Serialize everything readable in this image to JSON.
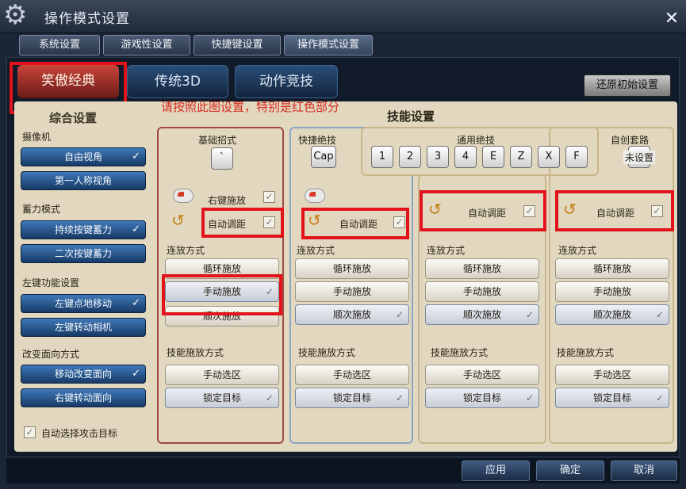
{
  "window": {
    "title": "操作模式设置",
    "close_glyph": "✕"
  },
  "top_tabs": [
    "系统设置",
    "游戏性设置",
    "快捷键设置",
    "操作模式设置"
  ],
  "mode_tabs": [
    "笑傲经典",
    "传统3D",
    "动作竞技"
  ],
  "restore_label": "还原初始设置",
  "notice": "请按照此图设置，特别是红色部分",
  "left": {
    "title": "综合设置",
    "camera_label": "摄像机",
    "camera_opts": [
      "自由视角",
      "第一人称视角"
    ],
    "charge_label": "蓄力模式",
    "charge_opts": [
      "持续按键蓄力",
      "二次按键蓄力"
    ],
    "leftkey_label": "左键功能设置",
    "leftkey_opts": [
      "左键点地移动",
      "左键转动相机"
    ],
    "facing_label": "改变面向方式",
    "facing_opts": [
      "移动改变面向",
      "右键转动面向"
    ],
    "auto_target": "自动选择攻击目标"
  },
  "skills_title": "技能设置",
  "groups": {
    "basic": "基础招式",
    "quick": "快捷绝技",
    "general": "通用绝技",
    "custom": "自创套路"
  },
  "keys": {
    "basic": "`",
    "quick": "Cap",
    "general": [
      "1",
      "2",
      "3",
      "4",
      "E",
      "Z",
      "X",
      "F"
    ],
    "custom_unset": "未设置"
  },
  "right_click_cast": "右键施放",
  "auto_range": "自动调距",
  "release_label": "连放方式",
  "release_opts": [
    "循环施放",
    "手动施放",
    "顺次施放"
  ],
  "cast_label": "技能施放方式",
  "cast_opts": [
    "手动选区",
    "锁定目标"
  ],
  "bottom": {
    "apply": "应用",
    "ok": "确定",
    "cancel": "取消"
  },
  "check_glyph": "✓",
  "colors": {
    "highlight_red": "#e2131a",
    "sheet": "#e2d8bf",
    "active_blue": "#2a5a96"
  }
}
